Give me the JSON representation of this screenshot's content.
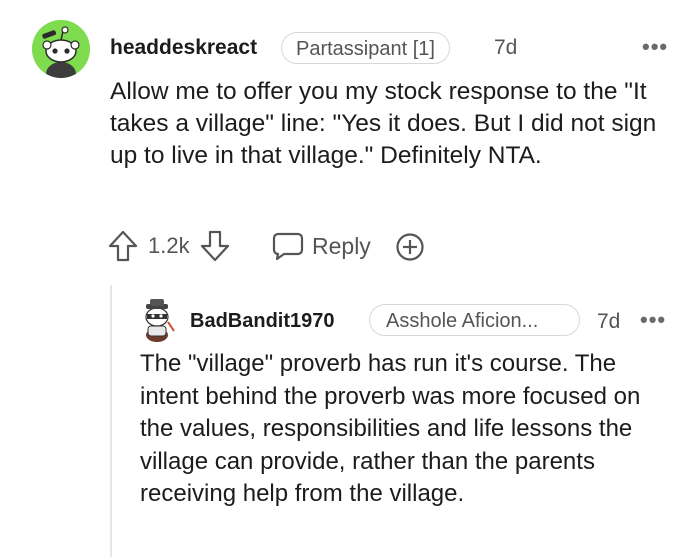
{
  "comment": {
    "username": "headdeskreact",
    "flair": "Partassipant [1]",
    "time": "7d",
    "more": "•••",
    "body": "Allow me to offer you my stock response to the \"It takes a village\" line: \"Yes it does. But I did not sign up to live in that village.\" Definitely NTA.",
    "votes": "1.2k",
    "reply_label": "Reply",
    "avatar_color": "#7edc4e"
  },
  "reply": {
    "username": "BadBandit1970",
    "flair": "Asshole Aficion...",
    "time": "7d",
    "more": "•••",
    "body": "The \"village\" proverb has run it's course. The intent behind the proverb was more focused on the values, responsibilities and life lessons the village can provide, rather than the parents receiving help from the village."
  }
}
